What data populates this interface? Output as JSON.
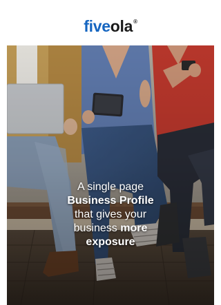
{
  "header": {
    "logo_part1": "five",
    "logo_part2": "ola",
    "logo_registered": "®"
  },
  "hero": {
    "line1": "A single page",
    "line2": "Business Profile",
    "line3": "that gives your",
    "line4_plain": "business ",
    "line4_bold": "more",
    "line5": "exposure"
  },
  "colors": {
    "brand_blue": "#1565c0",
    "logo_dark": "#1a1a1a",
    "tagline_text": "#ffffff"
  }
}
